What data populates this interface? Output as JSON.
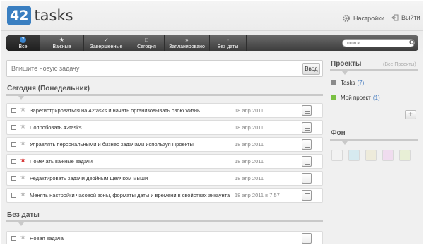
{
  "app": {
    "logo_number": "42",
    "logo_text": "tasks"
  },
  "header": {
    "settings_label": "Настройки",
    "logout_label": "Выйти"
  },
  "toolbar": {
    "tabs": [
      {
        "label": "Все",
        "icon": "?",
        "active": true
      },
      {
        "label": "Важные",
        "icon": "★"
      },
      {
        "label": "Завершенные",
        "icon": "✓"
      },
      {
        "label": "Сегодня",
        "icon": "□"
      },
      {
        "label": "Запланировано",
        "icon": "»"
      },
      {
        "label": "Без даты",
        "icon": "•"
      }
    ],
    "search_placeholder": "поиск"
  },
  "new_task": {
    "placeholder": "Впишите новую задачу",
    "button_label": "Ввод"
  },
  "today": {
    "title": "Сегодня (Понедельник)",
    "tasks": [
      {
        "text": "Зарегистрироваться на 42tasks и начать организовывать свою жизнь",
        "date": "18 апр 2011",
        "important": false
      },
      {
        "text": "Попробовать 42tasks",
        "date": "18 апр 2011",
        "important": false
      },
      {
        "text": "Управлять персональными и бизнес задачами используя Проекты",
        "date": "18 апр 2011",
        "important": false
      },
      {
        "text": "Помечать важные задачи",
        "date": "18 апр 2011",
        "important": true
      },
      {
        "text": "Редактировать задачи двойным щелчком мыши",
        "date": "18 апр 2011",
        "important": false
      },
      {
        "text": "Менять настройки часовой зоны, форматы даты и времени в свойствах аккаунта",
        "date": "18 апр 2011 в 7:57",
        "important": false
      }
    ]
  },
  "no_date": {
    "title": "Без даты",
    "tasks": [
      {
        "text": "Новая задача",
        "date": "",
        "important": false
      }
    ]
  },
  "projects": {
    "title": "Проекты",
    "subtitle": "(Все Проекты)",
    "items": [
      {
        "name": "Tasks",
        "count": "(7)",
        "color": "#8a8a8a"
      },
      {
        "name": "Мой проект",
        "count": "(1)",
        "color": "#7ac043"
      }
    ],
    "add_label": "+"
  },
  "background": {
    "title": "Фон",
    "swatches": [
      "#f2f2f2",
      "#d6eaf0",
      "#eeebdb",
      "#f0dcef",
      "#e8efd6"
    ]
  }
}
